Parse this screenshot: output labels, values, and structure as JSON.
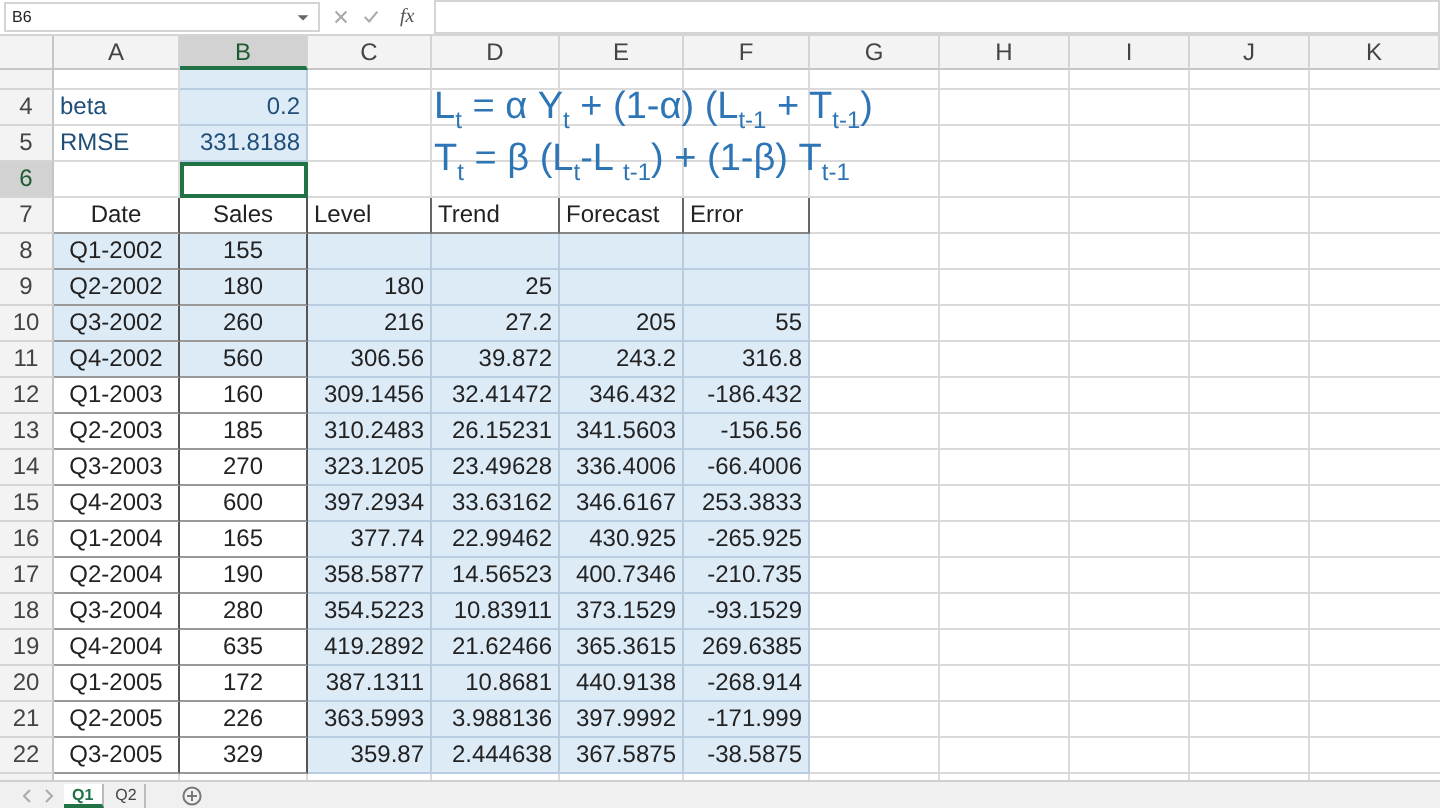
{
  "formula_bar": {
    "name_box": "B6",
    "function_button": "fx"
  },
  "columns": [
    {
      "label": "A",
      "selected": false
    },
    {
      "label": "B",
      "selected": true
    },
    {
      "label": "C",
      "selected": false
    },
    {
      "label": "D",
      "selected": false
    },
    {
      "label": "E",
      "selected": false
    },
    {
      "label": "F",
      "selected": false
    },
    {
      "label": "G",
      "selected": false
    },
    {
      "label": "H",
      "selected": false
    },
    {
      "label": "I",
      "selected": false
    },
    {
      "label": "J",
      "selected": false
    },
    {
      "label": "K",
      "selected": false
    }
  ],
  "rows": [
    {
      "kind": "clipped",
      "cells": [
        {
          "shaded": false
        },
        {
          "shaded": true
        }
      ]
    },
    {
      "number": "4",
      "kind": "param",
      "selected": false,
      "cells": [
        {
          "text": "beta",
          "kind": "label",
          "shaded": false
        },
        {
          "text": "0.2",
          "kind": "number",
          "shaded": true
        }
      ]
    },
    {
      "number": "5",
      "kind": "param",
      "selected": false,
      "cells": [
        {
          "text": "RMSE",
          "kind": "label",
          "shaded": false
        },
        {
          "text": "331.8188",
          "kind": "number",
          "shaded": true
        }
      ]
    },
    {
      "number": "6",
      "kind": "blank",
      "selected": true,
      "cells": [
        {
          "shaded": false,
          "active": false
        },
        {
          "shaded": false,
          "active": true
        }
      ]
    },
    {
      "number": "7",
      "kind": "header",
      "selected": false,
      "cells": [
        {
          "text": "Date",
          "kind": "centered",
          "shaded": false
        },
        {
          "text": "Sales",
          "kind": "centered",
          "shaded": false
        },
        {
          "text": "Level",
          "kind": "label",
          "shaded": false
        },
        {
          "text": "Trend",
          "kind": "label",
          "shaded": false
        },
        {
          "text": "Forecast",
          "kind": "label",
          "shaded": false
        },
        {
          "text": "Error",
          "kind": "label",
          "shaded": false
        }
      ]
    },
    {
      "number": "8",
      "kind": "data",
      "selected": false,
      "cells": [
        {
          "text": "Q1-2002",
          "kind": "centered",
          "shaded": true
        },
        {
          "text": "155",
          "kind": "centered",
          "shaded": true
        },
        {
          "shaded": true
        },
        {
          "shaded": true
        },
        {
          "shaded": true
        },
        {
          "shaded": true
        }
      ]
    },
    {
      "number": "9",
      "kind": "data",
      "selected": false,
      "cells": [
        {
          "text": "Q2-2002",
          "kind": "centered",
          "shaded": true
        },
        {
          "text": "180",
          "kind": "centered",
          "shaded": true
        },
        {
          "text": "180",
          "kind": "number",
          "shaded": true
        },
        {
          "text": "25",
          "kind": "number",
          "shaded": true
        },
        {
          "shaded": true
        },
        {
          "shaded": true
        }
      ]
    },
    {
      "number": "10",
      "kind": "data",
      "selected": false,
      "cells": [
        {
          "text": "Q3-2002",
          "kind": "centered",
          "shaded": true
        },
        {
          "text": "260",
          "kind": "centered",
          "shaded": true
        },
        {
          "text": "216",
          "kind": "number",
          "shaded": true
        },
        {
          "text": "27.2",
          "kind": "number",
          "shaded": true
        },
        {
          "text": "205",
          "kind": "number",
          "shaded": true
        },
        {
          "text": "55",
          "kind": "number",
          "shaded": true
        }
      ]
    },
    {
      "number": "11",
      "kind": "data",
      "selected": false,
      "cells": [
        {
          "text": "Q4-2002",
          "kind": "centered",
          "shaded": true
        },
        {
          "text": "560",
          "kind": "centered",
          "shaded": true
        },
        {
          "text": "306.56",
          "kind": "number",
          "shaded": true
        },
        {
          "text": "39.872",
          "kind": "number",
          "shaded": true
        },
        {
          "text": "243.2",
          "kind": "number",
          "shaded": true
        },
        {
          "text": "316.8",
          "kind": "number",
          "shaded": true
        }
      ]
    },
    {
      "number": "12",
      "kind": "data",
      "selected": false,
      "cells": [
        {
          "text": "Q1-2003",
          "kind": "centered",
          "shaded": false
        },
        {
          "text": "160",
          "kind": "centered",
          "shaded": false
        },
        {
          "text": "309.1456",
          "kind": "number",
          "shaded": true
        },
        {
          "text": "32.41472",
          "kind": "number",
          "shaded": true
        },
        {
          "text": "346.432",
          "kind": "number",
          "shaded": true
        },
        {
          "text": "-186.432",
          "kind": "number",
          "shaded": true
        }
      ]
    },
    {
      "number": "13",
      "kind": "data",
      "selected": false,
      "cells": [
        {
          "text": "Q2-2003",
          "kind": "centered",
          "shaded": false
        },
        {
          "text": "185",
          "kind": "centered",
          "shaded": false
        },
        {
          "text": "310.2483",
          "kind": "number",
          "shaded": true
        },
        {
          "text": "26.15231",
          "kind": "number",
          "shaded": true
        },
        {
          "text": "341.5603",
          "kind": "number",
          "shaded": true
        },
        {
          "text": "-156.56",
          "kind": "number",
          "shaded": true
        }
      ]
    },
    {
      "number": "14",
      "kind": "data",
      "selected": false,
      "cells": [
        {
          "text": "Q3-2003",
          "kind": "centered",
          "shaded": false
        },
        {
          "text": "270",
          "kind": "centered",
          "shaded": false
        },
        {
          "text": "323.1205",
          "kind": "number",
          "shaded": true
        },
        {
          "text": "23.49628",
          "kind": "number",
          "shaded": true
        },
        {
          "text": "336.4006",
          "kind": "number",
          "shaded": true
        },
        {
          "text": "-66.4006",
          "kind": "number",
          "shaded": true
        }
      ]
    },
    {
      "number": "15",
      "kind": "data",
      "selected": false,
      "cells": [
        {
          "text": "Q4-2003",
          "kind": "centered",
          "shaded": false
        },
        {
          "text": "600",
          "kind": "centered",
          "shaded": false
        },
        {
          "text": "397.2934",
          "kind": "number",
          "shaded": true
        },
        {
          "text": "33.63162",
          "kind": "number",
          "shaded": true
        },
        {
          "text": "346.6167",
          "kind": "number",
          "shaded": true
        },
        {
          "text": "253.3833",
          "kind": "number",
          "shaded": true
        }
      ]
    },
    {
      "number": "16",
      "kind": "data",
      "selected": false,
      "cells": [
        {
          "text": "Q1-2004",
          "kind": "centered",
          "shaded": false
        },
        {
          "text": "165",
          "kind": "centered",
          "shaded": false
        },
        {
          "text": "377.74",
          "kind": "number",
          "shaded": true
        },
        {
          "text": "22.99462",
          "kind": "number",
          "shaded": true
        },
        {
          "text": "430.925",
          "kind": "number",
          "shaded": true
        },
        {
          "text": "-265.925",
          "kind": "number",
          "shaded": true
        }
      ]
    },
    {
      "number": "17",
      "kind": "data",
      "selected": false,
      "cells": [
        {
          "text": "Q2-2004",
          "kind": "centered",
          "shaded": false
        },
        {
          "text": "190",
          "kind": "centered",
          "shaded": false
        },
        {
          "text": "358.5877",
          "kind": "number",
          "shaded": true
        },
        {
          "text": "14.56523",
          "kind": "number",
          "shaded": true
        },
        {
          "text": "400.7346",
          "kind": "number",
          "shaded": true
        },
        {
          "text": "-210.735",
          "kind": "number",
          "shaded": true
        }
      ]
    },
    {
      "number": "18",
      "kind": "data",
      "selected": false,
      "cells": [
        {
          "text": "Q3-2004",
          "kind": "centered",
          "shaded": false
        },
        {
          "text": "280",
          "kind": "centered",
          "shaded": false
        },
        {
          "text": "354.5223",
          "kind": "number",
          "shaded": true
        },
        {
          "text": "10.83911",
          "kind": "number",
          "shaded": true
        },
        {
          "text": "373.1529",
          "kind": "number",
          "shaded": true
        },
        {
          "text": "-93.1529",
          "kind": "number",
          "shaded": true
        }
      ]
    },
    {
      "number": "19",
      "kind": "data",
      "selected": false,
      "cells": [
        {
          "text": "Q4-2004",
          "kind": "centered",
          "shaded": false
        },
        {
          "text": "635",
          "kind": "centered",
          "shaded": false
        },
        {
          "text": "419.2892",
          "kind": "number",
          "shaded": true
        },
        {
          "text": "21.62466",
          "kind": "number",
          "shaded": true
        },
        {
          "text": "365.3615",
          "kind": "number",
          "shaded": true
        },
        {
          "text": "269.6385",
          "kind": "number",
          "shaded": true
        }
      ]
    },
    {
      "number": "20",
      "kind": "data",
      "selected": false,
      "cells": [
        {
          "text": "Q1-2005",
          "kind": "centered",
          "shaded": false
        },
        {
          "text": "172",
          "kind": "centered",
          "shaded": false
        },
        {
          "text": "387.1311",
          "kind": "number",
          "shaded": true
        },
        {
          "text": "10.8681",
          "kind": "number",
          "shaded": true
        },
        {
          "text": "440.9138",
          "kind": "number",
          "shaded": true
        },
        {
          "text": "-268.914",
          "kind": "number",
          "shaded": true
        }
      ]
    },
    {
      "number": "21",
      "kind": "data",
      "selected": false,
      "cells": [
        {
          "text": "Q2-2005",
          "kind": "centered",
          "shaded": false
        },
        {
          "text": "226",
          "kind": "centered",
          "shaded": false
        },
        {
          "text": "363.5993",
          "kind": "number",
          "shaded": true
        },
        {
          "text": "3.988136",
          "kind": "number",
          "shaded": true
        },
        {
          "text": "397.9992",
          "kind": "number",
          "shaded": true
        },
        {
          "text": "-171.999",
          "kind": "number",
          "shaded": true
        }
      ]
    },
    {
      "number": "22",
      "kind": "data",
      "selected": false,
      "cells": [
        {
          "text": "Q3-2005",
          "kind": "centered",
          "shaded": false
        },
        {
          "text": "329",
          "kind": "centered",
          "shaded": false
        },
        {
          "text": "359.87",
          "kind": "number",
          "shaded": true
        },
        {
          "text": "2.444638",
          "kind": "number",
          "shaded": true
        },
        {
          "text": "367.5875",
          "kind": "number",
          "shaded": true
        },
        {
          "text": "-38.5875",
          "kind": "number",
          "shaded": true
        }
      ]
    }
  ],
  "formulas": [
    "L$_{t}$ = α Y$_{t}$ + (1-α) (L$_{t-1}$ + T$_{t-1}$)",
    "T$_{t}$ = β (L$_{t}$-L $_{t-1}$) + (1-β) T$_{t-1}$"
  ],
  "sheet_tabs": [
    {
      "label": "Q1",
      "selected": true
    },
    {
      "label": "Q2",
      "selected": false
    }
  ]
}
